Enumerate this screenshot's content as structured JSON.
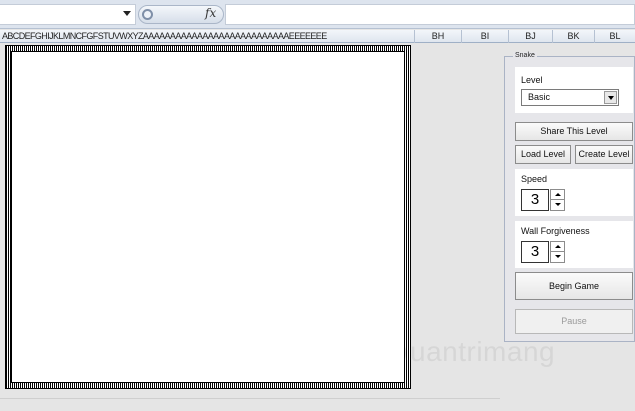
{
  "formula_bar": {
    "name_box": "",
    "fx_label": "fx",
    "formula_value": ""
  },
  "columns": {
    "compressed_headers": "ABCDEFGHIJKLMNCFGFSTUVWXYZAAAAAAAAAAAAAAAAAAAAAAAAAAAEEEEEEE",
    "visible": [
      "BH",
      "BI",
      "BJ",
      "BK",
      "BL"
    ]
  },
  "panel": {
    "legend": "Snake",
    "level_label": "Level",
    "level_value": "Basic",
    "share_button": "Share This Level",
    "load_button": "Load Level",
    "create_button": "Create Level",
    "speed_label": "Speed",
    "speed_value": "3",
    "forgiveness_label": "Wall Forgiveness",
    "forgiveness_value": "3",
    "begin_button": "Begin Game",
    "pause_button": "Pause"
  },
  "watermark": {
    "text": "uantrimang"
  },
  "icons": {
    "name_box_dropdown": "chevron-down-icon",
    "fx_pill": "function-icon",
    "level_dropdown": "chevron-down-icon",
    "spin_up": "arrow-up-icon",
    "spin_down": "arrow-down-icon",
    "watermark_logo": "quantrimang-logo-icon"
  }
}
